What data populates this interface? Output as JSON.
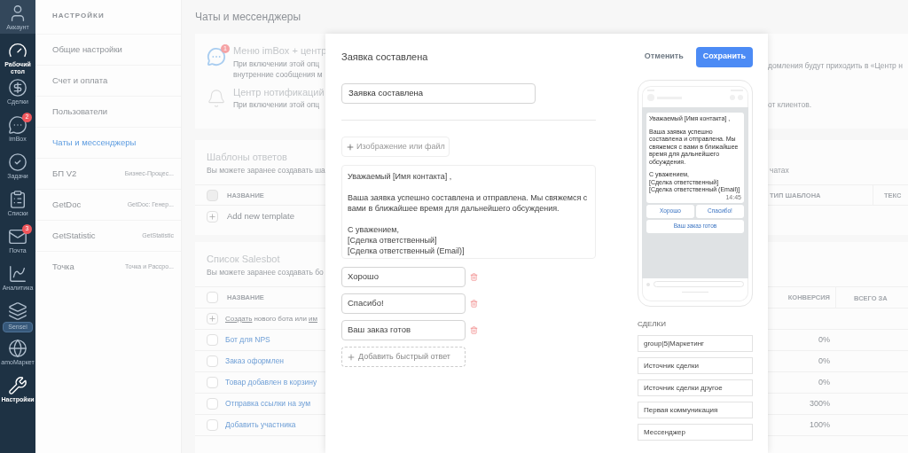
{
  "nav": [
    {
      "kind": "avatar",
      "label": "Аккаунт",
      "selected": false
    },
    {
      "kind": "dashboard",
      "label": "Рабочий стол",
      "selected": true
    },
    {
      "kind": "deals",
      "label": "Сделки",
      "selected": false
    },
    {
      "kind": "chat",
      "label": "imBox",
      "badge": "2",
      "selected": false
    },
    {
      "kind": "tasks",
      "label": "Задачи",
      "selected": false
    },
    {
      "kind": "lists",
      "label": "Списки",
      "selected": false
    },
    {
      "kind": "mail",
      "label": "Почта",
      "badge": "3",
      "selected": false
    },
    {
      "kind": "analytics",
      "label": "Аналитика",
      "selected": false
    },
    {
      "kind": "sensei",
      "label": "Sensei",
      "selected": false
    },
    {
      "kind": "market",
      "label": "amoМаркет",
      "selected": false
    },
    {
      "kind": "settings",
      "label": "Настройки",
      "selected": true
    }
  ],
  "settings_sidebar": {
    "title": "НАСТРОЙКИ",
    "items": [
      {
        "label": "Общие настройки",
        "selected": false
      },
      {
        "label": "Счет и оплата",
        "selected": false
      },
      {
        "label": "Пользователи",
        "selected": false
      },
      {
        "label": "Чаты и мессенджеры",
        "selected": true
      },
      {
        "label": "БП V2",
        "hint": "Бизнес-Процес...",
        "selected": false
      },
      {
        "label": "GetDoc",
        "hint": "GetDoc: Генер...",
        "selected": false
      },
      {
        "label": "GetStatistic",
        "hint": "GetStatistic",
        "selected": false
      },
      {
        "label": "Точка",
        "hint": "Точка и Рассро...",
        "selected": false
      }
    ]
  },
  "page_title": "Чаты и мессенджеры",
  "notifications": [
    {
      "kind": "chat",
      "title": "Меню imBox + центр",
      "badge": "1",
      "lines": [
        "При включении этой опц",
        "внутренние сообщения м"
      ],
      "tail": "домления будут приходить в «Центр н"
    },
    {
      "kind": "bell",
      "title": "Центр нотификаций",
      "lines": [
        "При включении этой опц"
      ],
      "tail": "от клиентов."
    }
  ],
  "templates": {
    "title": "Шаблоны ответов",
    "subtitle": "Вы можете заранее создавать ша",
    "subtitle_tail": "чатах",
    "column_name": "НАЗВАНИЕ",
    "header_checkbox": {
      "checked": false,
      "disabled": true
    },
    "columns_right": [
      "ТИП ШАБЛОНА",
      "ТЕКС"
    ],
    "add_row": "Add new template"
  },
  "salesbot": {
    "title": "Список Salesbot",
    "subtitle": "Вы можете заранее создавать бо",
    "column_name": "НАЗВАНИЕ",
    "header_checkbox": {
      "checked": false,
      "disabled": false
    },
    "columns_right": [
      "КОНВЕРСИЯ",
      "ВСЕГО ЗА"
    ],
    "create_row": {
      "link": "Создать",
      "text": "нового бота или",
      "link_2": "им"
    },
    "bots": [
      {
        "name": "Бот для NPS",
        "conversion": "0%",
        "checked": false
      },
      {
        "name": "Заказ оформлен",
        "conversion": "0%",
        "checked": false
      },
      {
        "name": "Товар добавлен в корзину",
        "conversion": "0%",
        "checked": false
      },
      {
        "name": "Отправка ссылки на зум",
        "conversion": "300%",
        "checked": false
      },
      {
        "name": "Добавить участника",
        "conversion": "100%",
        "checked": false
      }
    ]
  },
  "modal": {
    "title": "Заявка составлена",
    "cancel": "Отменить",
    "save": "Сохранить",
    "name_value": "Заявка составлена",
    "attach_button": "Изображение или файл",
    "message": [
      "Уважаемый [Имя контакта] ,",
      "Ваша заявка успешно составлена и отправлена. Мы свяжемся с вами в ближайшее время для дальнейшего обсуждения.",
      "С уважением,\n[Сделка ответственный]\n[Сделка ответственный (Email)]"
    ],
    "quick_replies": [
      "Хорошо",
      "Спасибо!",
      "Ваш заказ готов"
    ],
    "add_reply_button": "Добавить быстрый ответ",
    "preview": {
      "message": [
        "Уважаемый [Имя контакта] ,",
        "Ваша заявка успешно составлена и отправлена. Мы свяжемся с вами в ближайшее время для дальнейшего обсуждения.",
        "С уважением,\n[Сделка ответственный]\n[Сделка ответственный (Email)]"
      ],
      "time": "14:45",
      "buttons": [
        "Хорошо",
        "Спасибо!",
        "Ваш заказ готов"
      ]
    },
    "deals": {
      "title": "СДЕЛКИ",
      "fields": [
        "group|5|Маркетинг",
        "Источник сделки",
        "Источник сделки другое",
        "Первая коммуникация",
        "Мессенджер"
      ]
    }
  }
}
